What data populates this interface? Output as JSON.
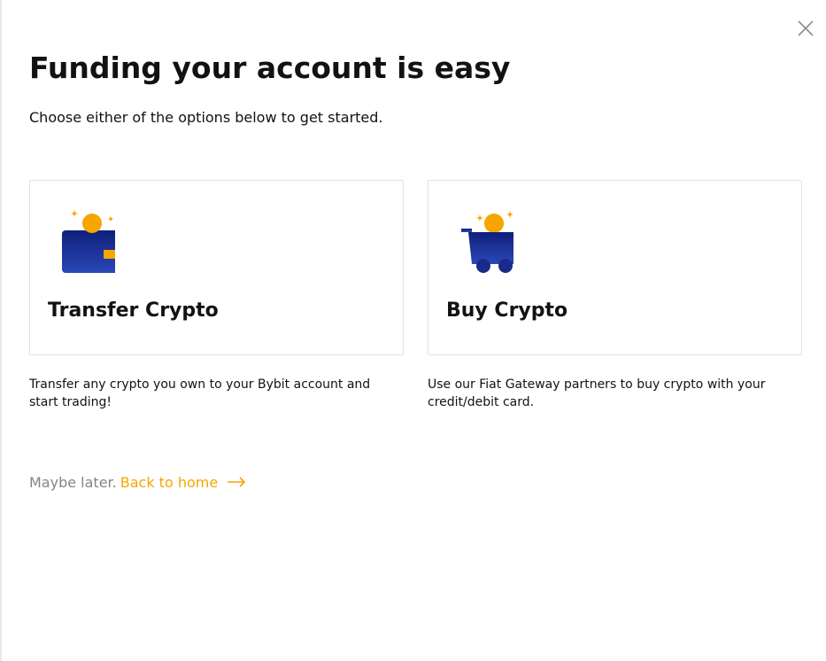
{
  "modal": {
    "title": "Funding your account is easy",
    "subtitle": "Choose either of the options below to get started."
  },
  "options": [
    {
      "icon": "wallet-coin-icon",
      "title": "Transfer Crypto",
      "description": "Transfer any crypto you own to your Bybit account and start trading!"
    },
    {
      "icon": "shopping-cart-coin-icon",
      "title": "Buy Crypto",
      "description": "Use our Fiat Gateway partners to buy crypto with your credit/debit card."
    }
  ],
  "footer": {
    "later_text": "Maybe later.",
    "back_link_label": "Back to home",
    "arrow_icon": "arrow-right-icon"
  },
  "colors": {
    "accent": "#f7a600",
    "icon_blue": "#1a2a8c",
    "icon_coin": "#f7a600",
    "text_primary": "#121214",
    "text_secondary": "#81858c",
    "card_border": "#e2e2e6"
  }
}
